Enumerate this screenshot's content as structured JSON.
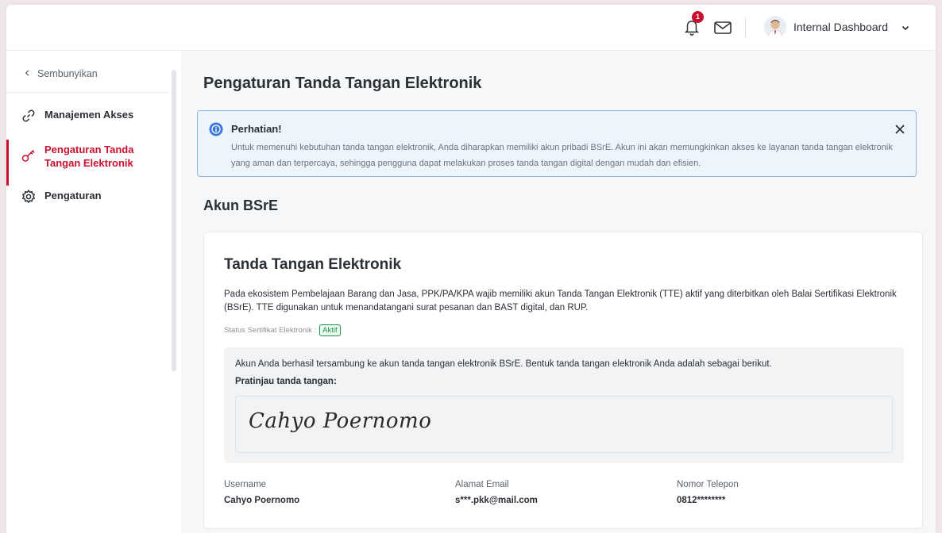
{
  "header": {
    "notification_count": "1",
    "user_name": "Internal Dashboard"
  },
  "sidebar": {
    "hide_label": "Sembunyikan",
    "items": [
      {
        "label": "Manajemen Akses",
        "icon": "link-icon",
        "active": false
      },
      {
        "label_line1": "Pengaturan Tanda",
        "label_line2": "Tangan Elektronik",
        "icon": "key-icon",
        "active": true
      },
      {
        "label": "Pengaturan",
        "icon": "gear-icon",
        "active": false
      }
    ]
  },
  "main": {
    "page_title": "Pengaturan Tanda Tangan Elektronik",
    "alert": {
      "title": "Perhatian!",
      "text": "Untuk memenuhi kebutuhan tanda tangan elektronik, Anda diharapkan memiliki akun pribadi BSrE. Akun ini akan memungkinkan akses ke layanan tanda tangan elektronik yang aman dan terpercaya, sehingga pengguna dapat melakukan proses tanda tangan digital dengan mudah dan efisien."
    },
    "section_title": "Akun BSrE",
    "card": {
      "title": "Tanda Tangan Elektronik",
      "description": "Pada ekosistem Pembelajaan Barang dan Jasa, PPK/PA/KPA wajib memiliki akun Tanda Tangan Elektronik (TTE) aktif yang diterbitkan oleh Balai Sertifikasi Elektronik (BSrE). TTE digunakan untuk menandatangani surat pesanan dan BAST digital, dan RUP.",
      "status_label": "Status Sertifikat Elektronik :",
      "status_value": "Aktif",
      "signature_message": "Akun Anda berhasil tersambung ke akun tanda tangan elektronik BSrE. Bentuk tanda tangan elektronik Anda adalah sebagai berikut.",
      "preview_label": "Pratinjau tanda tangan:",
      "signature_name": "Cahyo Poernomo"
    },
    "info": [
      {
        "label": "Username",
        "value": "Cahyo Poernomo"
      },
      {
        "label": "Alamat Email",
        "value": "s***.pkk@mail.com"
      },
      {
        "label": "Nomor Telepon",
        "value": "0812********"
      }
    ]
  },
  "colors": {
    "accent": "#c8102e",
    "info_border": "#8cb5ea",
    "info_bg": "#eef4fc",
    "status_green": "#17924a"
  }
}
